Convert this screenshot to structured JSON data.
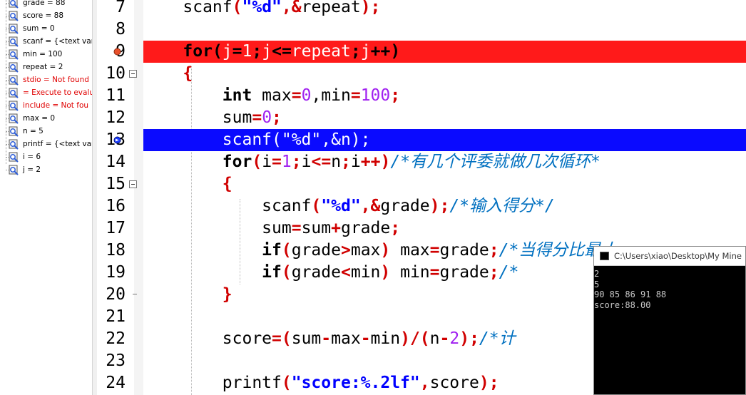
{
  "watch": {
    "items": [
      {
        "text": "grade = 88",
        "error": false
      },
      {
        "text": "score = 88",
        "error": false
      },
      {
        "text": "sum = 0",
        "error": false
      },
      {
        "text": "scanf = {<text vari",
        "error": false
      },
      {
        "text": "min = 100",
        "error": false
      },
      {
        "text": "repeat = 2",
        "error": false
      },
      {
        "text": "stdio = Not found",
        "error": true
      },
      {
        "text": " = Execute to evalu",
        "error": true
      },
      {
        "text": "include = Not fou",
        "error": true
      },
      {
        "text": "max = 0",
        "error": false
      },
      {
        "text": "n = 5",
        "error": false
      },
      {
        "text": "printf = {<text vari",
        "error": false
      },
      {
        "text": "i = 6",
        "error": false
      },
      {
        "text": "j = 2",
        "error": false
      }
    ]
  },
  "editor": {
    "lines": [
      {
        "num": "7",
        "state": "normal"
      },
      {
        "num": "8",
        "state": "normal"
      },
      {
        "num": "9",
        "state": "breakpoint"
      },
      {
        "num": "10",
        "state": "normal"
      },
      {
        "num": "11",
        "state": "normal"
      },
      {
        "num": "12",
        "state": "normal"
      },
      {
        "num": "13",
        "state": "current"
      },
      {
        "num": "14",
        "state": "normal"
      },
      {
        "num": "15",
        "state": "normal"
      },
      {
        "num": "16",
        "state": "normal"
      },
      {
        "num": "17",
        "state": "normal"
      },
      {
        "num": "18",
        "state": "normal"
      },
      {
        "num": "19",
        "state": "normal"
      },
      {
        "num": "20",
        "state": "normal"
      },
      {
        "num": "21",
        "state": "normal"
      },
      {
        "num": "22",
        "state": "normal"
      },
      {
        "num": "23",
        "state": "normal"
      },
      {
        "num": "24",
        "state": "normal"
      }
    ],
    "code": {
      "l7": [
        "    ",
        "scanf",
        "(",
        "\"%d\"",
        ",&",
        "repeat",
        ");"
      ],
      "l9": [
        "    ",
        "for",
        "(",
        "j",
        "=",
        "1",
        ";",
        "j",
        "<=",
        "repeat",
        ";",
        "j",
        "++",
        ")"
      ],
      "l10": [
        "    ",
        "{"
      ],
      "l11": [
        "        ",
        "int",
        " max",
        "=",
        "0",
        ",min",
        "=",
        "100",
        ";"
      ],
      "l12": [
        "        ",
        "sum",
        "=",
        "0",
        ";"
      ],
      "l13": [
        "        ",
        "scanf(\"%d\",&n);"
      ],
      "l14": [
        "        ",
        "for",
        "(",
        "i",
        "=",
        "1",
        ";",
        "i",
        "<=",
        "n",
        ";",
        "i",
        "++",
        ")",
        "/*有几个评委就做几次循环*"
      ],
      "l15": [
        "        ",
        "{"
      ],
      "l16": [
        "            ",
        "scanf",
        "(",
        "\"%d\"",
        ",&",
        "grade",
        ");",
        "/*输入得分*/"
      ],
      "l17": [
        "            ",
        "sum",
        "=",
        "sum",
        "+",
        "grade",
        ";"
      ],
      "l18": [
        "            ",
        "if",
        "(",
        "grade",
        ">",
        "max",
        ")",
        " max",
        "=",
        "grade",
        ";",
        "/*当得分比最大"
      ],
      "l19": [
        "            ",
        "if",
        "(",
        "grade",
        "<",
        "min",
        ")",
        " min",
        "=",
        "grade",
        ";",
        "/*"
      ],
      "l20": [
        "        ",
        "}"
      ],
      "l22": [
        "        ",
        "score",
        "=(",
        "sum",
        "-",
        "max",
        "-",
        "min",
        ")/(",
        "n",
        "-",
        "2",
        ");",
        "/*计"
      ],
      "l24": [
        "        ",
        "printf",
        "(",
        "\"score:%.2lf\"",
        ",",
        "score",
        ");"
      ]
    }
  },
  "console": {
    "title": "C:\\Users\\xiao\\Desktop\\My Mine",
    "output": [
      "2",
      "5",
      "90 85 86 91 88",
      "score:88.00"
    ]
  },
  "colors": {
    "breakpoint_line": "#ff1a1a",
    "current_line": "#0a0aff",
    "keyword": "#000000",
    "operator": "#d00000",
    "number": "#a020f0",
    "string": "#0000ff",
    "comment": "#0070c0",
    "error_text": "#e00000"
  }
}
